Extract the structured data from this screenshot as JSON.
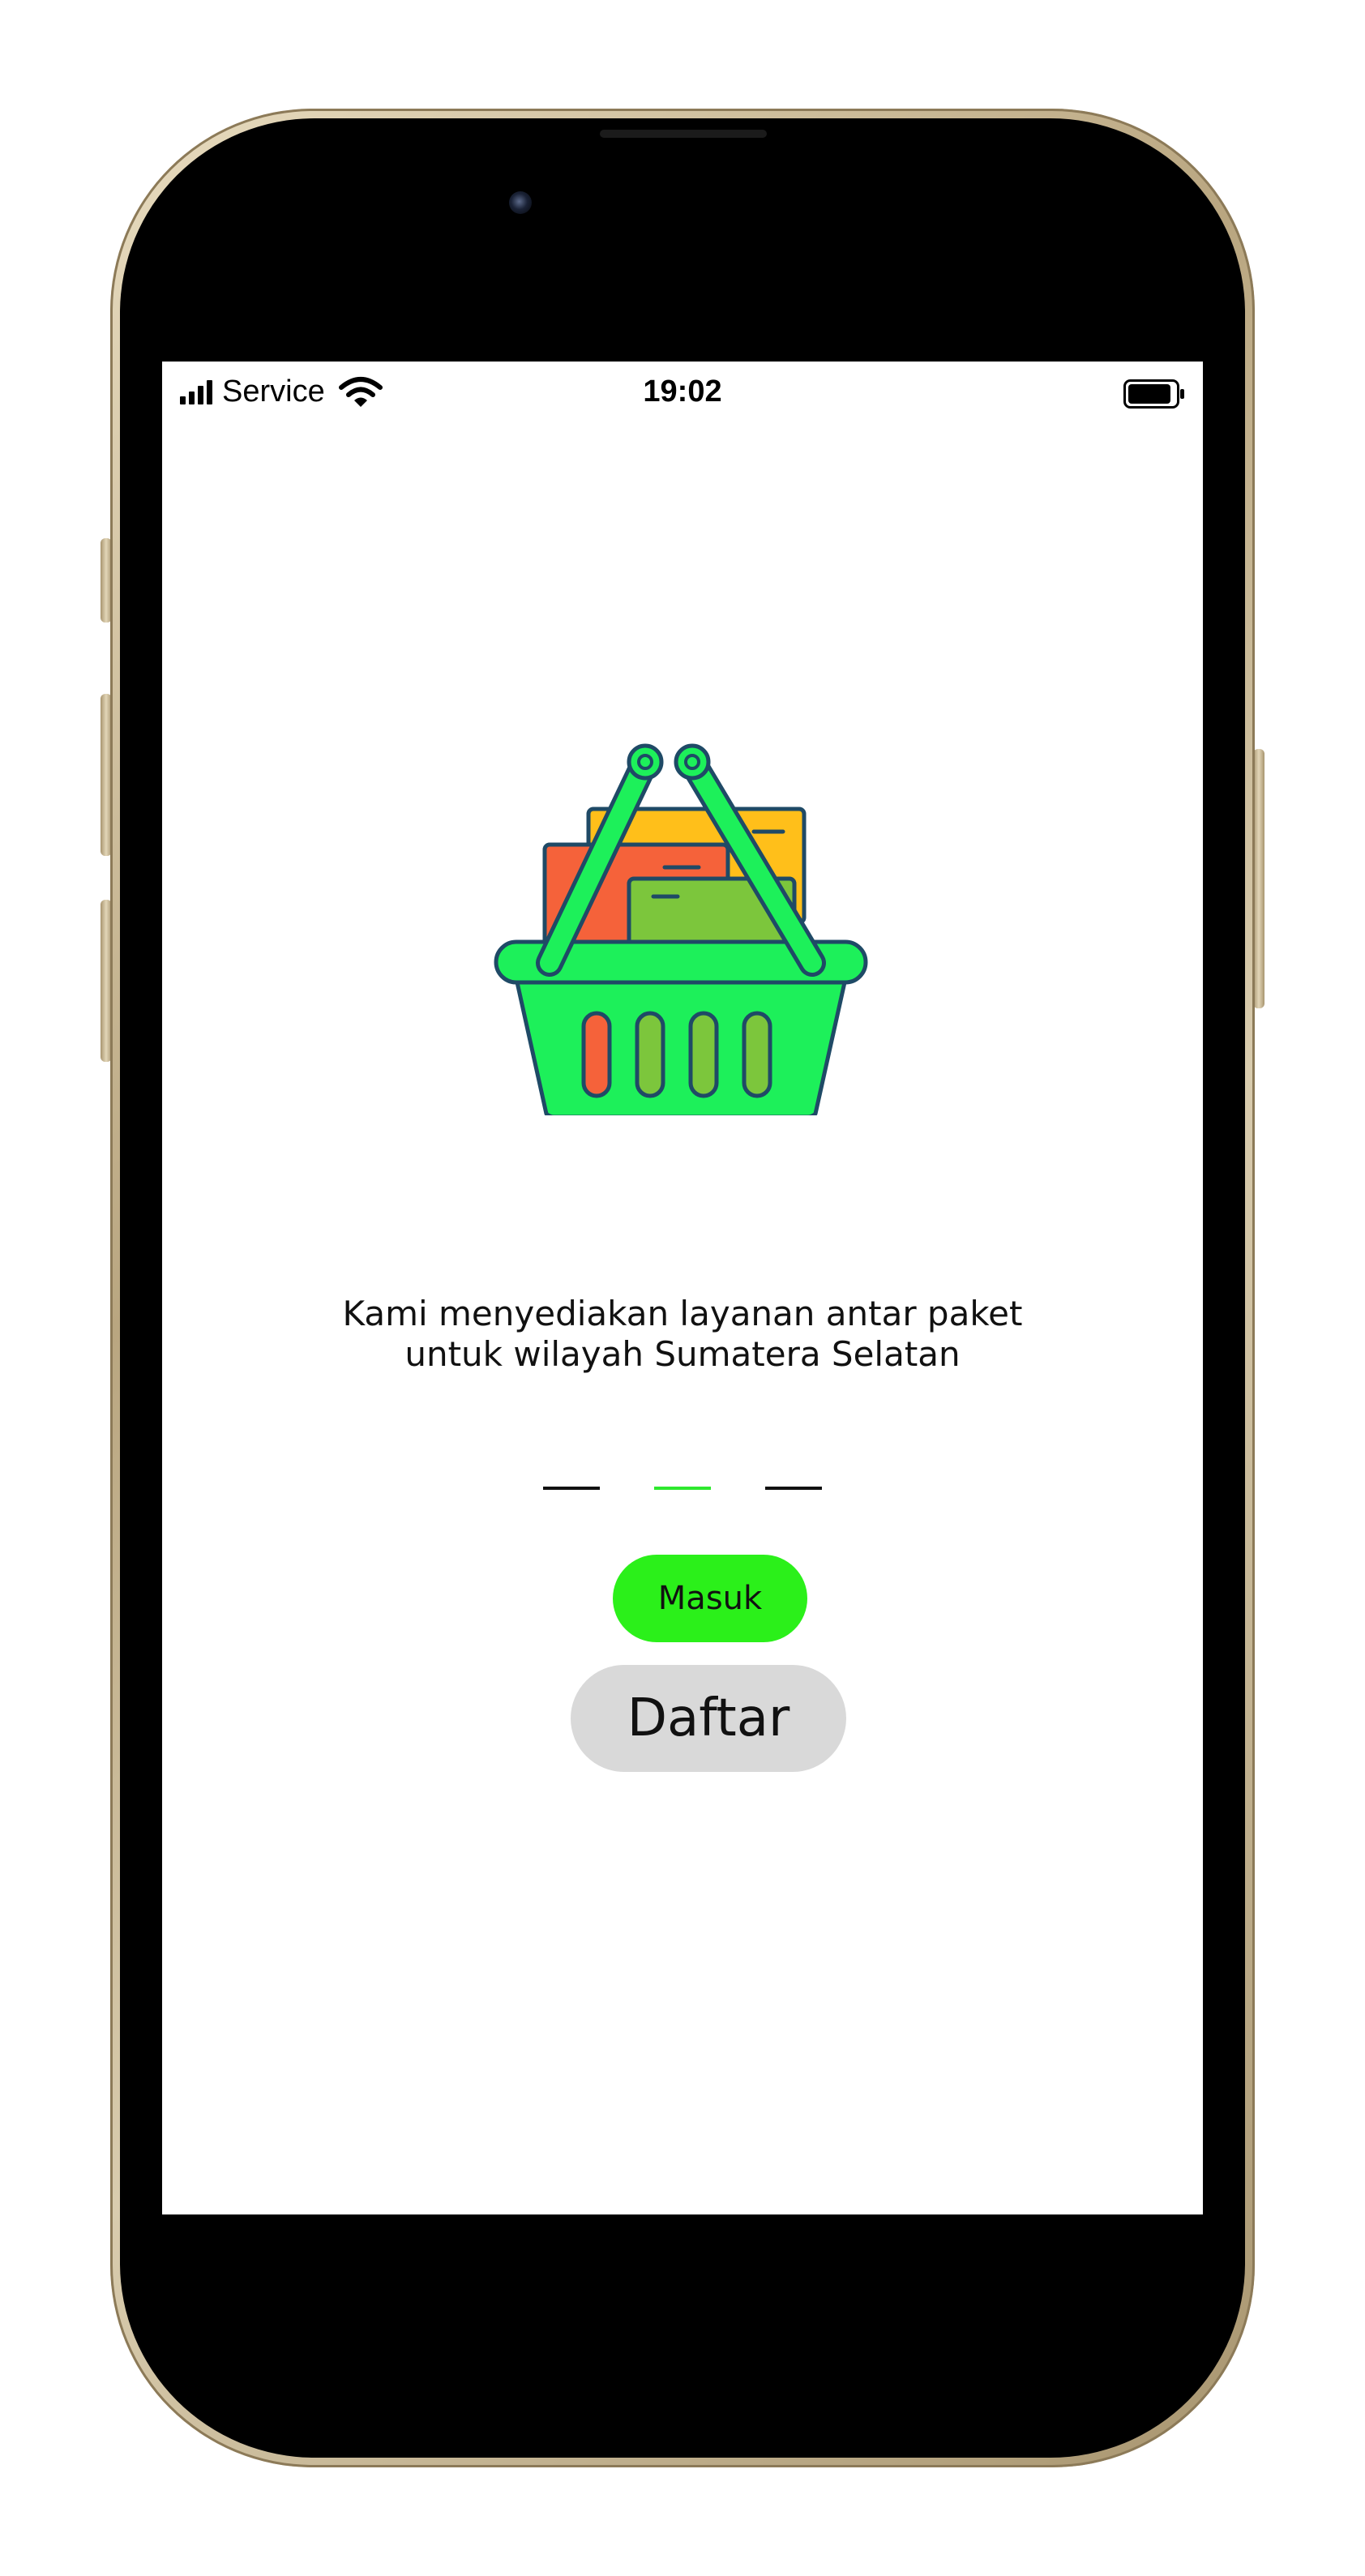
{
  "status_bar": {
    "carrier": "Service",
    "time": "19:02",
    "icons": [
      "signal-bars-icon",
      "wifi-icon",
      "battery-icon"
    ]
  },
  "hero": {
    "icon": "shopping-basket-icon"
  },
  "onboarding": {
    "tagline_line1": "Kami menyediakan layanan antar paket",
    "tagline_line2": "untuk wilayah Sumatera Selatan",
    "page_count": 3,
    "active_page": 2
  },
  "actions": {
    "login_label": "Masuk",
    "register_label": "Daftar"
  },
  "colors": {
    "accent_green": "#2bf01a",
    "indicator_active": "#2ee82e",
    "secondary_button": "#d9d9d9",
    "basket_green": "#1df05a",
    "basket_outline": "#1f4a66"
  }
}
